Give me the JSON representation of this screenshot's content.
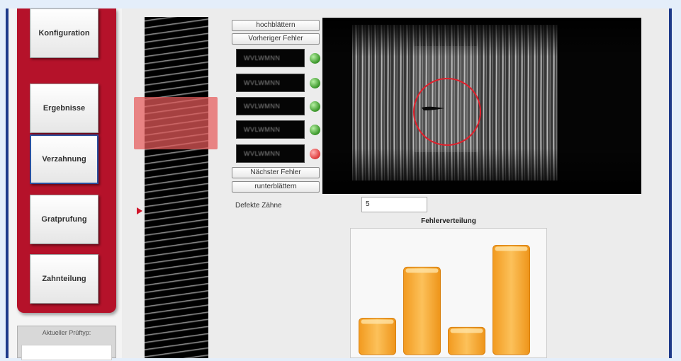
{
  "sidebar": {
    "nav": [
      {
        "label": "Konfiguration",
        "active": false
      },
      {
        "label": "Ergebnisse",
        "active": false
      },
      {
        "label": "Verzahnung",
        "active": true
      },
      {
        "label": "Gratprufung",
        "active": false
      },
      {
        "label": "Zahnteilung",
        "active": false
      }
    ],
    "status_label": "Aktueller Prüftyp:",
    "status_value": ""
  },
  "navigation": {
    "scroll_up": "hochblättern",
    "prev_error": "Vorheriger Fehler",
    "next_error": "Nächster Fehler",
    "scroll_down": "runterblättern"
  },
  "thumbnails": [
    {
      "text": "WVLWMNN",
      "status": "ok"
    },
    {
      "text": "WVLWMNN",
      "status": "ok"
    },
    {
      "text": "WVLWMNN",
      "status": "ok"
    },
    {
      "text": "WVLWMNN",
      "status": "ok"
    },
    {
      "text": "WVLWMNN",
      "status": "error"
    }
  ],
  "defects": {
    "label": "Defekte Zähne",
    "value": "5"
  },
  "colors": {
    "brand_red": "#b5122a",
    "highlight_red": "#e65a5a",
    "led_ok": "#3f9a2e",
    "led_error": "#e04040",
    "bar_orange": "#f5a623"
  },
  "chart_data": {
    "type": "bar",
    "title": "Fehlerverteilung",
    "categories": [
      "",
      "",
      "",
      ""
    ],
    "values": [
      1,
      2.4,
      0.75,
      3
    ],
    "ylim": [
      0,
      3.3
    ],
    "xlabel": "",
    "ylabel": "",
    "grid": false,
    "legend": "none"
  }
}
